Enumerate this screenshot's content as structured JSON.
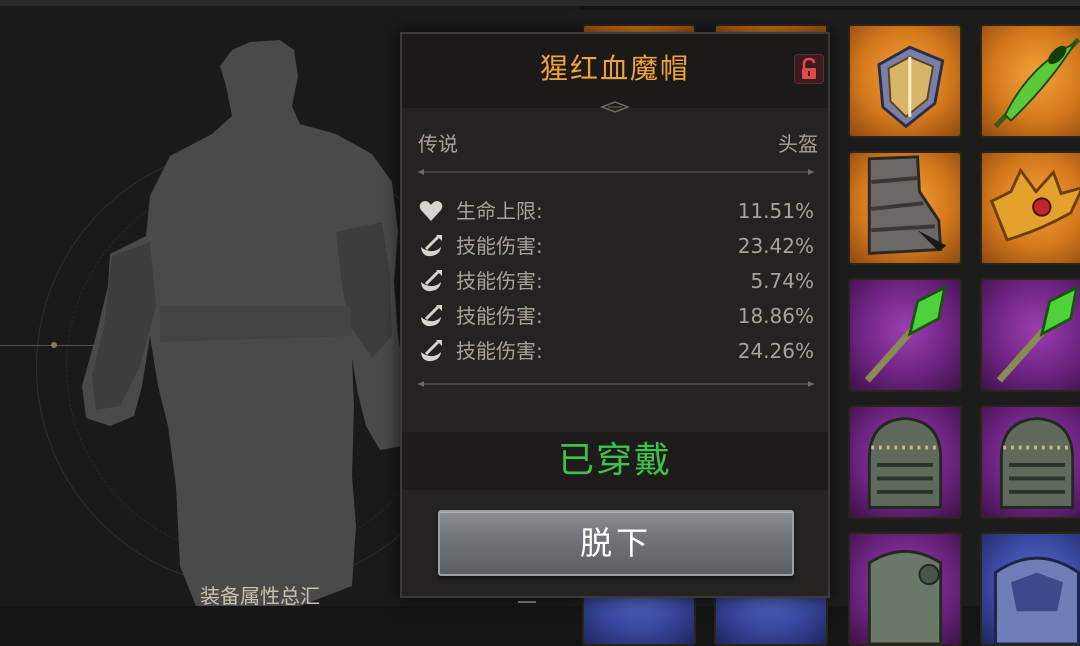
{
  "character_panel": {
    "summary_label": "装备属性总汇"
  },
  "tooltip": {
    "title": "猩红血魔帽",
    "rarity": "传说",
    "slot": "头盔",
    "stats": [
      {
        "icon": "heart-icon",
        "name": "生命上限:",
        "value": "11.51%"
      },
      {
        "icon": "skill-damage-icon",
        "name": "技能伤害:",
        "value": "23.42%"
      },
      {
        "icon": "skill-damage-icon",
        "name": "技能伤害:",
        "value": "5.74%"
      },
      {
        "icon": "skill-damage-icon",
        "name": "技能伤害:",
        "value": "18.86%"
      },
      {
        "icon": "skill-damage-icon",
        "name": "技能伤害:",
        "value": "24.26%"
      }
    ],
    "status": "已穿戴",
    "unequip_label": "脱下"
  },
  "inventory": {
    "items": [
      {
        "icon": "shield-icon",
        "rarity": "orange"
      },
      {
        "icon": "feather-icon",
        "rarity": "orange"
      },
      {
        "icon": "boots-icon",
        "rarity": "orange"
      },
      {
        "icon": "crown-icon",
        "rarity": "orange"
      },
      {
        "icon": "staff-icon",
        "rarity": "purple"
      },
      {
        "icon": "staff-icon",
        "rarity": "purple"
      },
      {
        "icon": "helmet-icon",
        "rarity": "purple"
      },
      {
        "icon": "helmet-icon",
        "rarity": "purple"
      },
      {
        "icon": "armor-icon",
        "rarity": "purple"
      },
      {
        "icon": "armor-icon",
        "rarity": "blue"
      }
    ]
  },
  "colors": {
    "title": "#f0a23c",
    "worn": "#3ec24c",
    "orange_bg": "#d4781c",
    "purple_bg": "#6e2483",
    "blue_bg": "#3a48a0"
  }
}
